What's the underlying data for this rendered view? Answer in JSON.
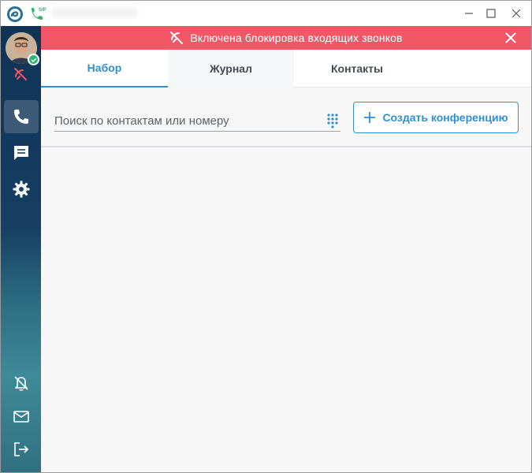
{
  "titlebar": {
    "logo_icon": "app-logo-icon",
    "sip_icon": "phone-sip-icon",
    "sip_label": "SIP",
    "minimize_icon": "minimize-icon",
    "maximize_icon": "maximize-icon",
    "close_icon": "close-icon"
  },
  "sidebar": {
    "avatar_icon": "avatar",
    "status_icon": "check-icon",
    "status_color": "#2bb673",
    "dnd_icon": "call-blocked-icon",
    "items": [
      {
        "name": "calls",
        "icon": "phone-icon",
        "active": true
      },
      {
        "name": "chat",
        "icon": "chat-icon",
        "active": false
      },
      {
        "name": "settings",
        "icon": "gear-icon",
        "active": false
      },
      {
        "name": "notifications",
        "icon": "bell-off-icon",
        "active": false
      },
      {
        "name": "mail",
        "icon": "mail-icon",
        "active": false
      },
      {
        "name": "logout",
        "icon": "logout-icon",
        "active": false
      }
    ]
  },
  "banner": {
    "text": "Включена блокировка входящих звонков",
    "icon": "call-blocked-icon",
    "color": "#f25767",
    "close_icon": "close-icon"
  },
  "tabs": [
    {
      "label": "Набор",
      "active": true
    },
    {
      "label": "Журнал",
      "active": false
    },
    {
      "label": "Контакты",
      "active": false
    }
  ],
  "search": {
    "placeholder": "Поиск по контактам или номеру",
    "value": "",
    "dialpad_icon": "dialpad-icon"
  },
  "conference_button": {
    "label": "Создать конференцию",
    "icon": "plus-icon"
  },
  "colors": {
    "accent": "#2f8fd2",
    "banner": "#f25767",
    "sidebar_top": "#0f3356",
    "sidebar_bottom": "#31707f"
  }
}
